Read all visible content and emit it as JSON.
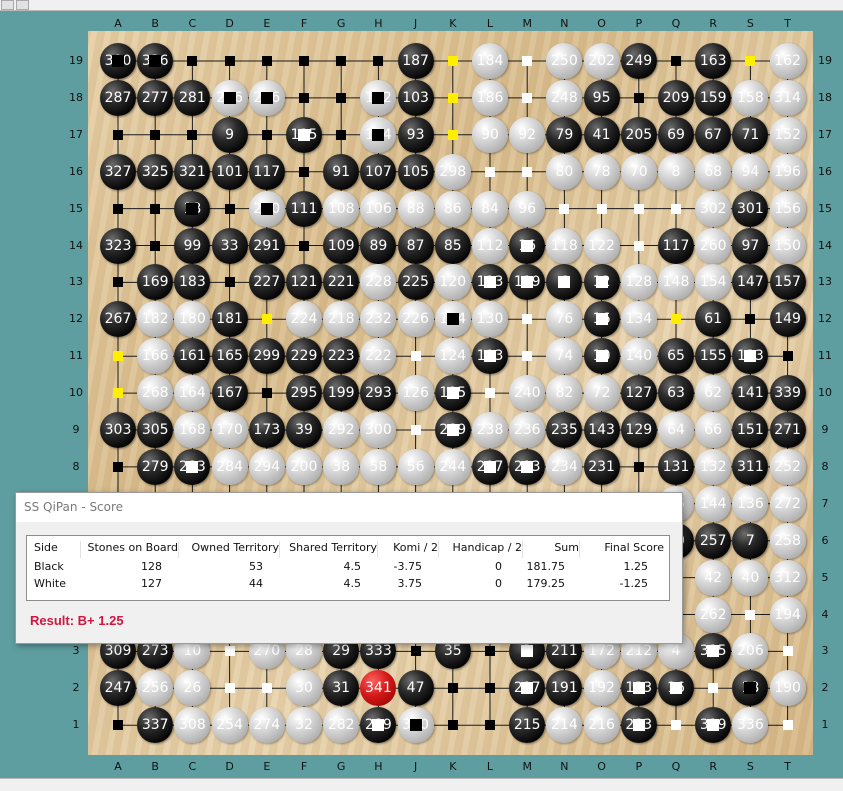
{
  "board": {
    "columns": [
      "A",
      "B",
      "C",
      "D",
      "E",
      "F",
      "G",
      "H",
      "J",
      "K",
      "L",
      "M",
      "N",
      "O",
      "P",
      "Q",
      "R",
      "S",
      "T"
    ],
    "rows": [
      "19",
      "18",
      "17",
      "16",
      "15",
      "14",
      "13",
      "12",
      "11",
      "10",
      "9",
      "8",
      "7",
      "6",
      "5",
      "4",
      "3",
      "2",
      "1"
    ],
    "row_items": [
      [
        "B:300",
        "B:336",
        "b",
        "b",
        "b",
        "b",
        "b",
        "b",
        "B:187",
        "y",
        "W:184",
        "w",
        "W:250",
        "W:202",
        "B:249",
        "b",
        "B:163",
        "y",
        "W:162"
      ],
      [
        "B:287",
        "B:277",
        "B:281",
        "W:286",
        "W:276",
        "b",
        "b",
        "W:142",
        "B:103",
        "y",
        "W:186",
        "w",
        "W:248",
        "B:95",
        "b",
        "B:209",
        "B:159",
        "W:158",
        "W:314"
      ],
      [
        "b",
        "b",
        "b",
        "B:9",
        "b",
        "B:115",
        "b",
        "W:114",
        "B:93",
        "y",
        "W:90",
        "W:92",
        "B:79",
        "B:41",
        "B:205",
        "B:69",
        "B:67",
        "B:71",
        "W:152"
      ],
      [
        "B:327",
        "B:325",
        "B:321",
        "B:101",
        "B:117",
        "b",
        "B:91",
        "B:107",
        "B:105",
        "W:298",
        "w",
        "w",
        "W:80",
        "W:78",
        "W:70",
        "W:8",
        "W:68",
        "W:94",
        "W:196"
      ],
      [
        "b",
        "b",
        "B:18",
        "b",
        "W:210",
        "B:111",
        "W:108",
        "W:106",
        "W:88",
        "W:86",
        "W:84",
        "W:96",
        "w",
        "w",
        "w",
        "w",
        "W:302",
        "B:301",
        "W:156"
      ],
      [
        "B:323",
        "b",
        "B:99",
        "B:33",
        "B:291",
        "b",
        "B:109",
        "B:89",
        "B:87",
        "B:85",
        "W:112",
        "B:16",
        "W:118",
        "W:122",
        "w",
        "B:117",
        "W:260",
        "B:97",
        "W:150"
      ],
      [
        "b",
        "B:169",
        "B:183",
        "b",
        "B:227",
        "B:121",
        "B:221",
        "W:228",
        "B:225",
        "W:120",
        "B:113",
        "B:119",
        "B:6",
        "B:12",
        "W:128",
        "W:148",
        "W:154",
        "B:147",
        "B:157"
      ],
      [
        "B:267",
        "W:182",
        "W:180",
        "B:181",
        "y",
        "W:224",
        "W:218",
        "W:232",
        "W:226",
        "W:114",
        "W:130",
        "w",
        "W:76",
        "B:16",
        "W:134",
        "y",
        "B:61",
        "b",
        "B:149"
      ],
      [
        "y",
        "W:166",
        "B:161",
        "B:165",
        "B:299",
        "B:229",
        "B:223",
        "W:222",
        "w",
        "W:124",
        "B:113",
        "w",
        "W:74",
        "B:10",
        "W:140",
        "B:65",
        "B:155",
        "B:133",
        "b"
      ],
      [
        "y",
        "W:268",
        "W:164",
        "B:167",
        "b",
        "B:295",
        "B:199",
        "B:293",
        "W:126",
        "B:115",
        "w",
        "W:240",
        "W:82",
        "W:72",
        "B:127",
        "B:63",
        "W:62",
        "B:141",
        "B:339"
      ],
      [
        "B:303",
        "B:305",
        "W:168",
        "W:170",
        "B:173",
        "B:39",
        "W:292",
        "W:300",
        "w",
        "B:289",
        "W:238",
        "W:236",
        "B:235",
        "B:143",
        "B:129",
        "W:64",
        "W:66",
        "B:151",
        "B:271"
      ],
      [
        "b",
        "B:279",
        "B:283",
        "W:284",
        "W:294",
        "W:200",
        "W:38",
        "W:58",
        "W:56",
        "W:244",
        "B:217",
        "B:213",
        "W:234",
        "B:231",
        "b",
        "B:131",
        "W:132",
        "B:311",
        "W:252"
      ],
      [
        "",
        "",
        "",
        "",
        "",
        "",
        "",
        "",
        "",
        "",
        "",
        "",
        "",
        "",
        "",
        "W:26",
        "W:144",
        "W:136",
        "W:272"
      ],
      [
        "",
        "",
        "",
        "",
        "",
        "",
        "",
        "",
        "",
        "",
        "",
        "",
        "",
        "",
        "",
        "B:30",
        "B:257",
        "B:7",
        "W:258"
      ],
      [
        "",
        "",
        "",
        "",
        "",
        "",
        "",
        "",
        "",
        "",
        "",
        "",
        "",
        "",
        "",
        "",
        "W:42",
        "W:40",
        "W:312"
      ],
      [
        "",
        "",
        "",
        "",
        "",
        "",
        "",
        "",
        "",
        "",
        "",
        "",
        "",
        "",
        "",
        "",
        "W:262",
        "w",
        "W:194"
      ],
      [
        "B:309",
        "B:273",
        "W:10",
        "w",
        "W:270",
        "W:28",
        "B:29",
        "B:333",
        "b",
        "B:35",
        "b",
        "B:2",
        "B:211",
        "W:172",
        "W:212",
        "W:4",
        "B:315",
        "W:206",
        "w"
      ],
      [
        "B:247",
        "W:256",
        "W:26",
        "w",
        "w",
        "W:30",
        "B:31",
        "R:341",
        "B:47",
        "b",
        "b",
        "B:217",
        "B:191",
        "W:192",
        "B:133",
        "B:16",
        "w",
        "B:18",
        "W:190"
      ],
      [
        "b",
        "B:337",
        "W:308",
        "W:254",
        "W:274",
        "W:32",
        "W:282",
        "B:289",
        "W:310",
        "b",
        "b",
        "B:215",
        "W:214",
        "W:216",
        "B:283",
        "w",
        "B:319",
        "W:336",
        "w"
      ]
    ]
  },
  "dialog": {
    "title": "SS QiPan - Score",
    "headers": [
      "Side",
      "Stones on Board",
      "Owned Territory",
      "Shared Territory",
      "Komi / 2",
      "Handicap / 2",
      "Sum",
      "Final Score"
    ],
    "rows": [
      [
        "Black",
        "128",
        "53",
        "4.5",
        "-3.75",
        "0",
        "181.75",
        "1.25"
      ],
      [
        "White",
        "127",
        "44",
        "4.5",
        "3.75",
        "0",
        "179.25",
        "-1.25"
      ]
    ],
    "result": "Result: B+ 1.25"
  },
  "colors": {
    "background": "#5f9ea0",
    "result_text": "#d1163f"
  }
}
